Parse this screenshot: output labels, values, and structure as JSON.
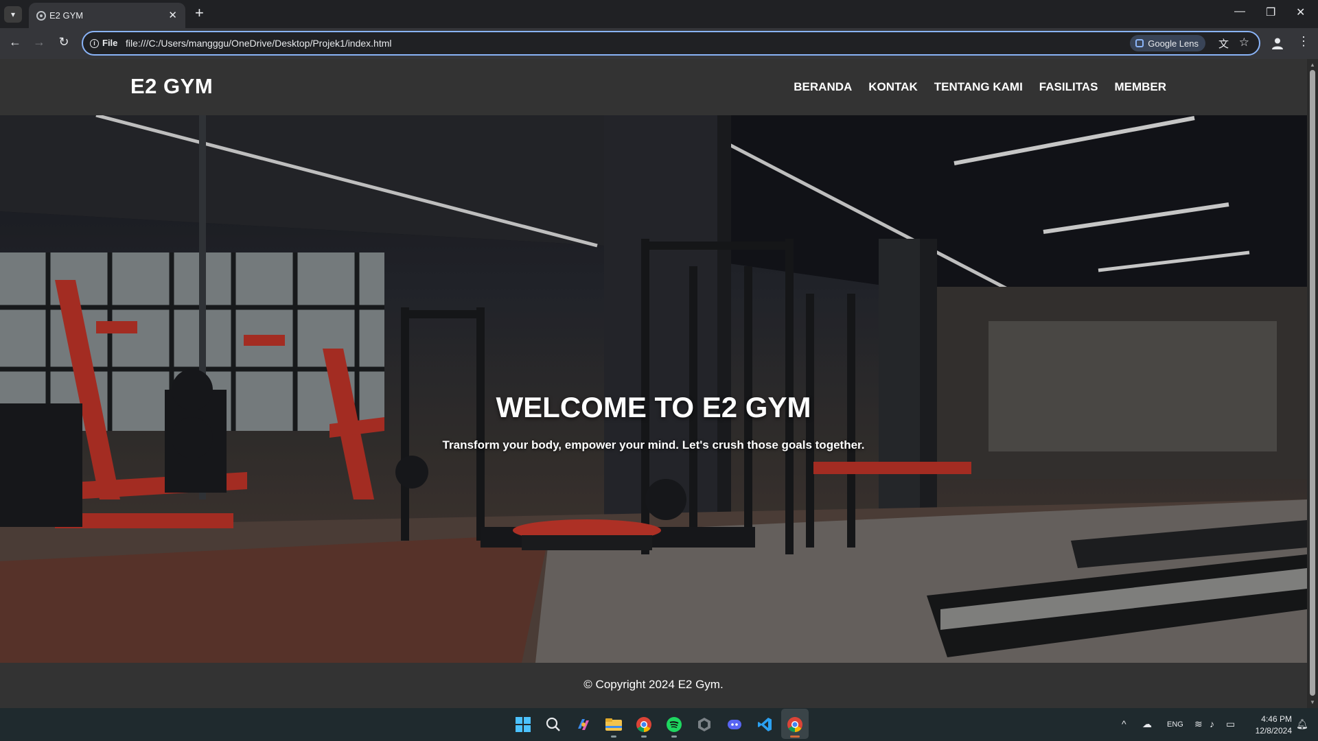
{
  "browser": {
    "tab_title": "E2 GYM",
    "url_chip": "File",
    "url": "file:///C:/Users/mangggu/OneDrive/Desktop/Projek1/index.html",
    "lens_label": "Google Lens"
  },
  "site": {
    "logo": "E2 GYM",
    "nav": [
      "BERANDA",
      "KONTAK",
      "TENTANG KAMI",
      "FASILITAS",
      "MEMBER"
    ],
    "hero_title": "WELCOME TO E2 GYM",
    "hero_subtitle": "Transform your body, empower your mind. Let's crush those goals together.",
    "footer": "© Copyright 2024 E2 Gym.",
    "colors": {
      "header_bg": "#333333",
      "accent_red": "#c7362a"
    }
  },
  "taskbar": {
    "apps": [
      "windows-start",
      "search",
      "copilot",
      "file-explorer",
      "chrome",
      "spotify",
      "github-desktop",
      "discord",
      "vscode",
      "chrome-active"
    ],
    "language": "ENG",
    "time": "4:46 PM",
    "date": "12/8/2024"
  }
}
